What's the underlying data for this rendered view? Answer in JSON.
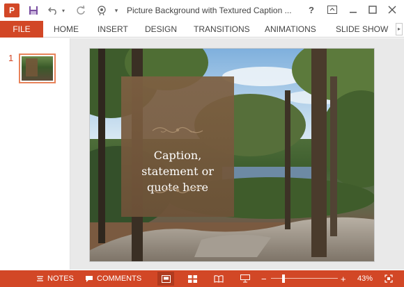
{
  "app": {
    "logo_letter": "P",
    "document_title": "Picture Background with Textured Caption ...",
    "accent_color": "#d24726"
  },
  "quick_access": {
    "icons": [
      "save-icon",
      "undo-icon",
      "redo-icon",
      "present-from-start-icon",
      "customize-qat-icon"
    ]
  },
  "window_controls": {
    "help": "?",
    "icons": [
      "ribbon-display-icon",
      "minimize-icon",
      "maximize-icon",
      "close-icon"
    ]
  },
  "ribbon": {
    "file_label": "FILE",
    "tabs": [
      "HOME",
      "INSERT",
      "DESIGN",
      "TRANSITIONS",
      "ANIMATIONS",
      "SLIDE SHOW"
    ],
    "scroll_glyph": "▸"
  },
  "thumbnails": {
    "slide_number": "1"
  },
  "slide": {
    "caption_line1": "Caption,",
    "caption_line2": "statement or",
    "caption_line3": "quote here"
  },
  "statusbar": {
    "notes_label": "NOTES",
    "comments_label": "COMMENTS",
    "zoom_minus": "−",
    "zoom_plus": "+",
    "zoom_percent": "43%",
    "zoom_level": 0.43
  }
}
